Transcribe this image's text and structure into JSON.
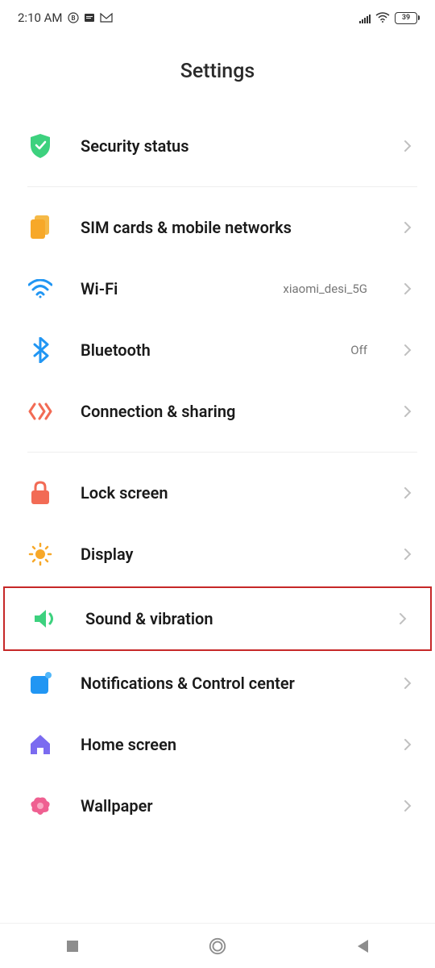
{
  "status": {
    "time": "2:10 AM",
    "battery": "39"
  },
  "page": {
    "title": "Settings"
  },
  "rows": {
    "security": {
      "label": "Security status"
    },
    "sim": {
      "label": "SIM cards & mobile networks"
    },
    "wifi": {
      "label": "Wi-Fi",
      "value": "xiaomi_desi_5G"
    },
    "bluetooth": {
      "label": "Bluetooth",
      "value": "Off"
    },
    "connection": {
      "label": "Connection & sharing"
    },
    "lock": {
      "label": "Lock screen"
    },
    "display": {
      "label": "Display"
    },
    "sound": {
      "label": "Sound & vibration"
    },
    "notifications": {
      "label": "Notifications & Control center"
    },
    "home": {
      "label": "Home screen"
    },
    "wallpaper": {
      "label": "Wallpaper"
    }
  }
}
